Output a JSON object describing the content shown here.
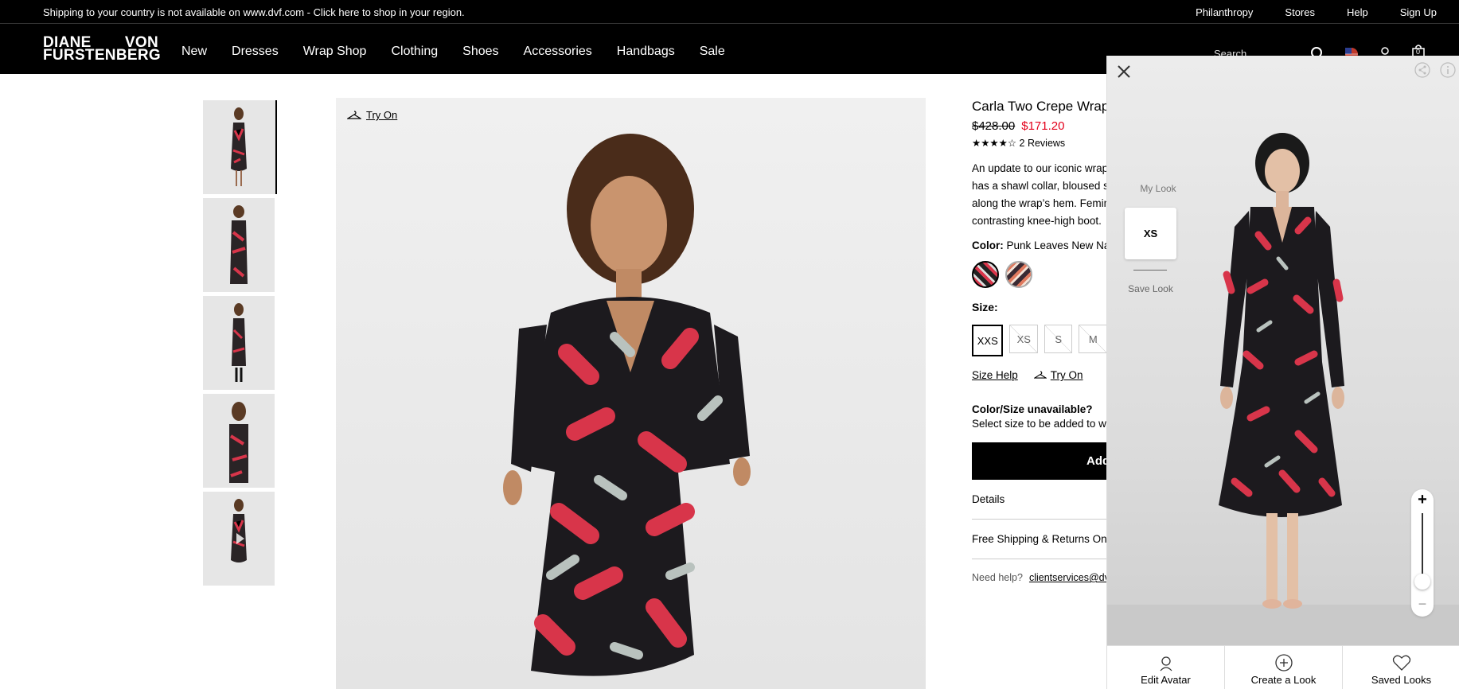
{
  "topbar": {
    "message": "Shipping to your country is not available on www.dvf.com - Click here to shop in your region.",
    "links": [
      "Philanthropy",
      "Stores",
      "Help",
      "Sign Up"
    ]
  },
  "header": {
    "logo_line1a": "DIANE",
    "logo_line1b": "VON",
    "logo_line2": "FURSTENBERG",
    "nav": [
      "New",
      "Dresses",
      "Wrap Shop",
      "Clothing",
      "Shoes",
      "Accessories",
      "Handbags",
      "Sale"
    ],
    "search_label": "Search",
    "cart_count": "0"
  },
  "gallery": {
    "try_on": "Try On"
  },
  "product": {
    "title": "Carla Two Crepe Wrap",
    "old_price": "$428.00",
    "new_price": "$171.20",
    "stars": "★★★★☆",
    "reviews": "2 Reviews",
    "desc_lines": [
      "An update to our iconic wrap",
      "has a shawl collar, bloused sl",
      "along the wrap’s hem. Femini",
      "contrasting knee-high boot."
    ],
    "color_label": "Color:",
    "color_value": "Punk Leaves New Nav",
    "size_label": "Size:",
    "sizes": [
      "XXS",
      "XS",
      "S",
      "M"
    ],
    "size_help": "Size Help",
    "try_on": "Try On",
    "unavailable_title": "Color/Size unavailable?",
    "unavailable_sub": "Select size to be added to wa",
    "add_button": "Add",
    "details": "Details",
    "shipping": "Free Shipping & Returns On A",
    "need_help": "Need help?",
    "email": "clientservices@dvf."
  },
  "tryon_panel": {
    "my_look": "My Look",
    "look_size": "XS",
    "save_look": "Save Look",
    "zoom_plus": "+",
    "zoom_minus": "−",
    "zoom_level": 0.1,
    "bottom": [
      "Edit Avatar",
      "Create a Look",
      "Saved Looks"
    ]
  }
}
